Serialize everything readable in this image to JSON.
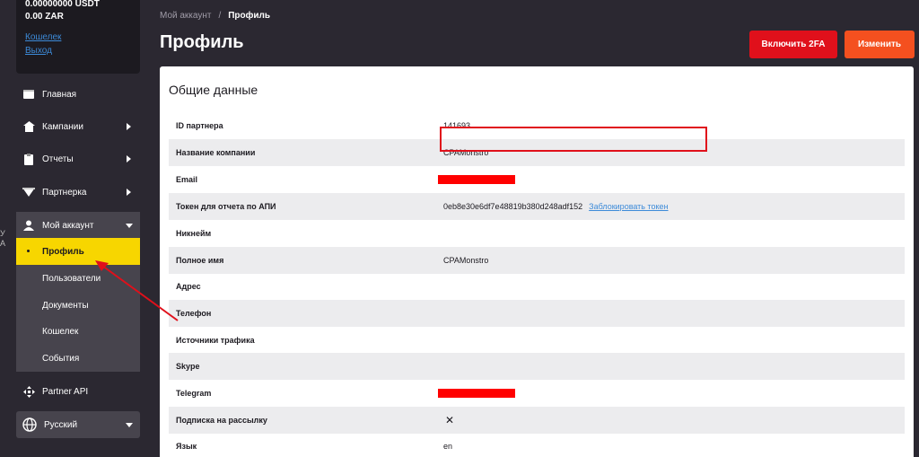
{
  "sidebar": {
    "balance": {
      "line1": "0.00000000 USDT",
      "line2": "0.00 ZAR",
      "wallet_link": "Кошелек",
      "logout_link": "Выход"
    },
    "items": [
      {
        "label": "Главная",
        "icon": "home-icon"
      },
      {
        "label": "Кампании",
        "icon": "campaign-icon"
      },
      {
        "label": "Отчеты",
        "icon": "reports-icon"
      },
      {
        "label": "Партнерка",
        "icon": "partner-icon"
      },
      {
        "label": "Мой аккаунт",
        "icon": "user-icon"
      },
      {
        "label": "Partner API",
        "icon": "api-icon"
      }
    ],
    "account_submenu": [
      "Профиль",
      "Пользователи",
      "Документы",
      "Кошелек",
      "События"
    ],
    "language": "Русский",
    "edge_marks": [
      "У",
      "А"
    ]
  },
  "header": {
    "breadcrumb_parent": "Мой аккаунт",
    "breadcrumb_sep": "/",
    "breadcrumb_current": "Профиль",
    "title": "Профиль",
    "btn_2fa": "Включить 2FA",
    "btn_edit": "Изменить"
  },
  "profile": {
    "section_title": "Общие данные",
    "rows": [
      {
        "label": "ID партнера",
        "value": "141693"
      },
      {
        "label": "Название компании",
        "value": "CPAMonstro"
      },
      {
        "label": "Email",
        "value": ""
      },
      {
        "label": "Токен для отчета по АПИ",
        "value": "0eb8e30e6df7e48819b380d248adf152"
      },
      {
        "label": "Никнейм",
        "value": ""
      },
      {
        "label": "Полное имя",
        "value": "CPAMonstro"
      },
      {
        "label": "Адрес",
        "value": ""
      },
      {
        "label": "Телефон",
        "value": ""
      },
      {
        "label": "Источники трафика",
        "value": ""
      },
      {
        "label": "Skype",
        "value": ""
      },
      {
        "label": "Telegram",
        "value": ""
      },
      {
        "label": "Подписка на рассылку",
        "value": "✕"
      },
      {
        "label": "Язык",
        "value": "en"
      }
    ],
    "token_block_link": "Заблокировать токен"
  },
  "colors": {
    "sidebar_bg": "#2b2831",
    "active_yellow": "#f7d600",
    "btn_red": "#e0101b",
    "btn_orange": "#f4501f",
    "link_blue": "#3d8bd9",
    "annotation_red": "#e0101b"
  }
}
